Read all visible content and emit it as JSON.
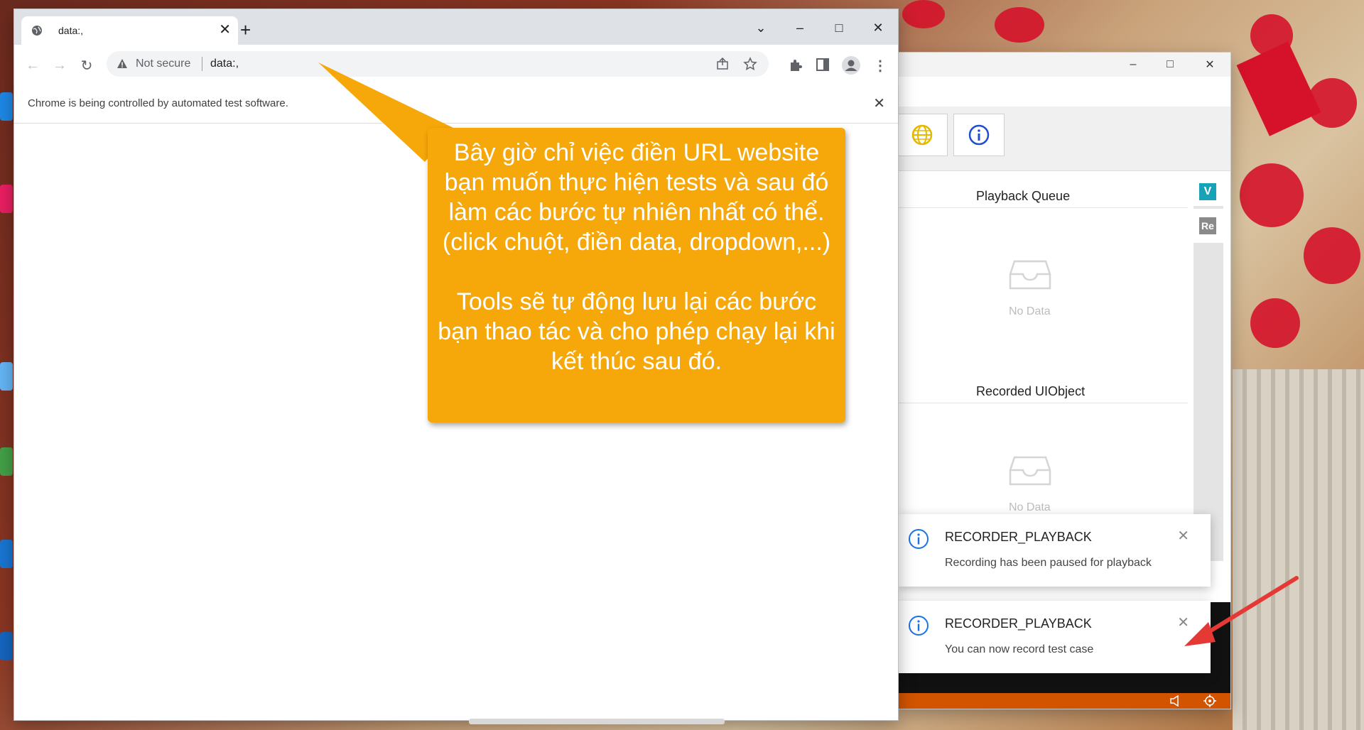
{
  "browser": {
    "tab_title": "data:,",
    "security_label": "Not secure",
    "url": "data:,",
    "infobar_text": "Chrome is being controlled by automated test software."
  },
  "callout": {
    "text": "Bây giờ chỉ việc điền URL website bạn muốn thực hiện tests và sau đó làm các bước tự nhiên nhất có thể. (click chuột, điền data, dropdown,...)\n\nTools sẽ tự động lưu lại các bước bạn thao tác và cho phép chạy lại khi kết thúc sau đó."
  },
  "recorder": {
    "playback_queue_title": "Playback Queue",
    "recorded_title": "Recorded UIObject",
    "no_data": "No Data",
    "side_v": "V",
    "side_re": "Re"
  },
  "notifications": [
    {
      "title": "RECORDER_PLAYBACK",
      "message": "Recording has been paused for playback"
    },
    {
      "title": "RECORDER_PLAYBACK",
      "message": "You can now record test case"
    }
  ],
  "colors": {
    "callout": "#f6a70a",
    "status_bar": "#d35400",
    "info_blue": "#1a73e8",
    "arrow_red": "#e53935"
  },
  "icons": [
    "globe-icon",
    "info-icon",
    "inbox-icon",
    "warning-icon",
    "close-icon"
  ]
}
